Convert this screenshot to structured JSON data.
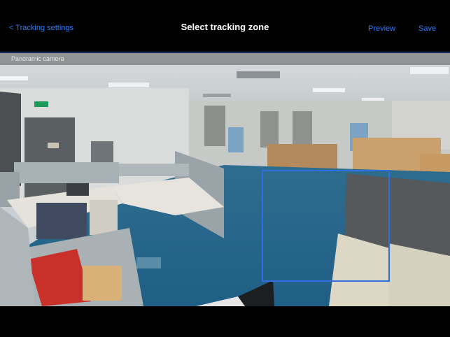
{
  "header": {
    "back_label": "< Tracking settings",
    "title": "Select tracking zone",
    "preview_label": "Preview",
    "save_label": "Save"
  },
  "camera": {
    "label": "Panoramic camera"
  },
  "colors": {
    "accent": "#2f7cf6",
    "zone_border": "#2f6fe0",
    "background": "#000000"
  }
}
